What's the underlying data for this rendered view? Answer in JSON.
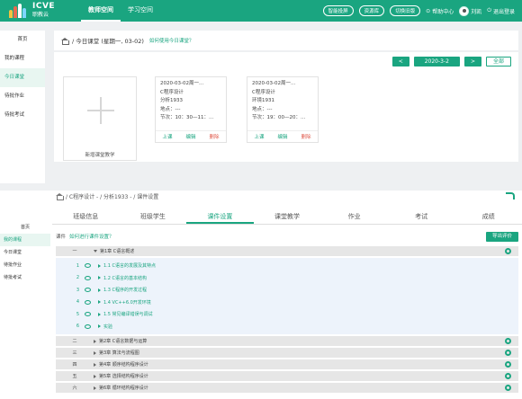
{
  "header": {
    "logo_en": "ICVE",
    "logo_cn": "职教云",
    "nav": [
      "教师空间",
      "学习空间"
    ],
    "pills": [
      "智能投屏",
      "资源库",
      "切换旧版"
    ],
    "help": "帮助中心",
    "user": "刘凯",
    "logout": "退出登录"
  },
  "sidebar": {
    "items": [
      "首页",
      "我的课程",
      "今日课堂",
      "待批作业",
      "待批考试"
    ]
  },
  "today": {
    "breadcrumb": "/ 今日课堂 (星期一, 03-02)",
    "hint": "如何使用今日课堂？",
    "prev": "<",
    "date": "2020-3-2",
    "next": ">",
    "all": "全部",
    "new_card": "新增课堂教学",
    "cards": [
      {
        "date": "2020-03-02周一...",
        "course": "C程序设计",
        "class": "分析1933",
        "place": "地点：---",
        "time": "节次：10：30—11：...",
        "start": "上课",
        "edit": "编辑",
        "del": "删除"
      },
      {
        "date": "2020-03-02周一...",
        "course": "C程序设计",
        "class": "环境1931",
        "place": "地点：---",
        "time": "节次：19：00—20：...",
        "start": "上课",
        "edit": "编辑",
        "del": "删除"
      }
    ]
  },
  "courseware": {
    "breadcrumb": "/ C程序设计 - / 分析1933 - / 课件设置",
    "tabs": [
      "班级信息",
      "班级学生",
      "课件设置",
      "课堂教学",
      "作业",
      "考试",
      "成绩"
    ],
    "active_tab": "课件设置",
    "label": "课件",
    "hint": "如何进行课件设置？",
    "export": "导出评价",
    "chapters": [
      {
        "num": "一",
        "title": "第1章 C语言概述",
        "open": true,
        "sections": [
          {
            "n": "1",
            "title": "1.1 C语言的发展及其特点"
          },
          {
            "n": "2",
            "title": "1.2 C语言的基本结构"
          },
          {
            "n": "3",
            "title": "1.3 C程序的开发过程"
          },
          {
            "n": "4",
            "title": "1.4 VC++6.0开发环境"
          },
          {
            "n": "5",
            "title": "1.5 常见编译错误与调试"
          },
          {
            "n": "6",
            "title": "实验"
          }
        ]
      },
      {
        "num": "二",
        "title": "第2章 C语言数据与运算"
      },
      {
        "num": "三",
        "title": "第3章 算法与流程图"
      },
      {
        "num": "四",
        "title": "第4章 顺序结构程序设计"
      },
      {
        "num": "五",
        "title": "第5章 选择结构程序设计"
      },
      {
        "num": "六",
        "title": "第6章 循环结构程序设计"
      }
    ]
  },
  "colors": {
    "brand": "#1aa580",
    "danger": "#e05a4c"
  }
}
